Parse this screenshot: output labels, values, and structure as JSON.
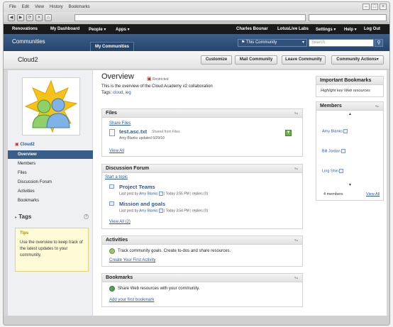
{
  "browser": {
    "menu": [
      "File",
      "Edit",
      "View",
      "History",
      "Bookmarks"
    ],
    "nav_glyphs": [
      "◀",
      "▶",
      "⟳",
      "✕",
      "⌂"
    ]
  },
  "topbar": {
    "left": [
      "Renovations",
      "My Dashboard",
      "People ▾",
      "Apps ▾"
    ],
    "right": [
      "Charles Bounar",
      "LotusLive Labs",
      "Settings ▾",
      "Help ▾",
      "Log Out"
    ]
  },
  "communities_bar": {
    "title": "Communities",
    "tab": "My Communities",
    "scope": "This Community",
    "search_placeholder": "Search"
  },
  "page_header": {
    "title": "Cloud2",
    "buttons": [
      "Customize",
      "Mail Community",
      "Leave Community",
      "Community Actions▾"
    ]
  },
  "left_nav": {
    "community_name": "Cloud2",
    "items": [
      "Overview",
      "Members",
      "Files",
      "Discussion Forum",
      "Activities",
      "Bookmarks"
    ],
    "tags_label": "Tags",
    "tips": {
      "title": "Tips",
      "text": "Use the overview to keep track of the latest updates to your community."
    }
  },
  "overview": {
    "title": "Overview",
    "restricted": "Restricted",
    "description": "This is the overview of the Cloud Academy v2 collaboration",
    "tags_label": "Tags:",
    "tags": [
      "cloud",
      "ieg"
    ]
  },
  "files": {
    "title": "Files",
    "share_link": "Share Files",
    "file_name": "test.asc.txt",
    "file_shared": "Shared from Files",
    "file_meta": "Amy Blanks updated 6/29/10",
    "view_all": "View All"
  },
  "forum": {
    "title": "Discussion Forum",
    "start_topic": "Start a topic",
    "topics": [
      {
        "title": "Project Teams",
        "meta_prefix": "Last post by",
        "author": "Amy Blanks",
        "meta_suffix": "| Today 3:55 PM | replies (0)"
      },
      {
        "title": "Mission and goals",
        "meta_prefix": "Last post by",
        "author": "Amy Blanks",
        "meta_suffix": "| Today 3:54 PM | replies (0)"
      }
    ],
    "view_all": "View All (2)"
  },
  "activities": {
    "title": "Activities",
    "text": "Track community goals. Create to-dos and share resources.",
    "link": "Create Your First Activity"
  },
  "bookmarks": {
    "title": "Bookmarks",
    "text": "Share Web resources with your community.",
    "link": "Add your first bookmark"
  },
  "important_bookmarks": {
    "title": "Important Bookmarks",
    "text": "Highlight key Web resources"
  },
  "members": {
    "title": "Members",
    "list": [
      "Amy Blanks",
      "Bill Jordan",
      "Ling Shin"
    ],
    "count": "4 members",
    "view_all": "View All"
  }
}
